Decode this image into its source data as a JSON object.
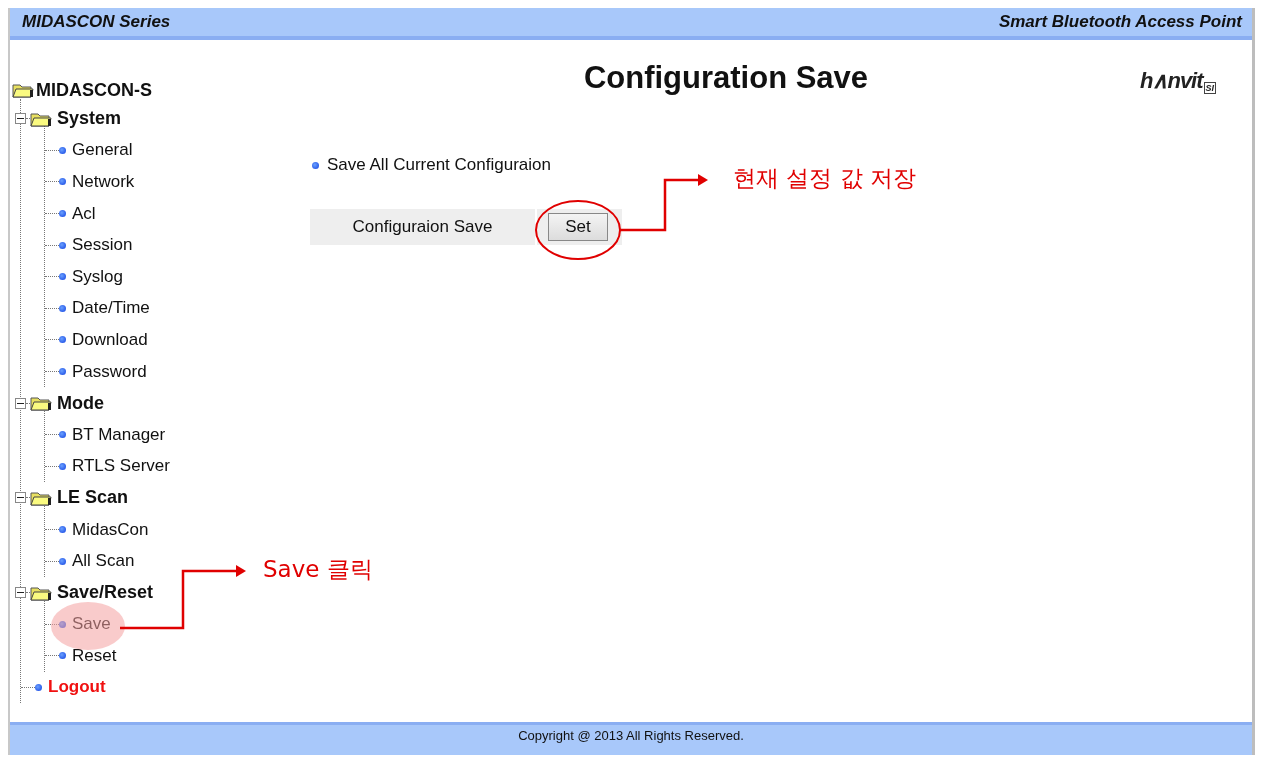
{
  "header": {
    "left": "MIDASCON Series",
    "right": "Smart Bluetooth Access Point"
  },
  "tree": {
    "label": "MIDASCON-S",
    "children": [
      {
        "label": "System",
        "kind": "group",
        "expanded": true,
        "children": [
          {
            "label": "General",
            "kind": "page"
          },
          {
            "label": "Network",
            "kind": "page"
          },
          {
            "label": "Acl",
            "kind": "page"
          },
          {
            "label": "Session",
            "kind": "page"
          },
          {
            "label": "Syslog",
            "kind": "page"
          },
          {
            "label": "Date/Time",
            "kind": "page"
          },
          {
            "label": "Download",
            "kind": "page"
          },
          {
            "label": "Password",
            "kind": "page"
          }
        ]
      },
      {
        "label": "Mode",
        "kind": "group",
        "expanded": true,
        "children": [
          {
            "label": "BT Manager",
            "kind": "page"
          },
          {
            "label": "RTLS Server",
            "kind": "page"
          }
        ]
      },
      {
        "label": "LE Scan",
        "kind": "group",
        "expanded": true,
        "children": [
          {
            "label": "MidasCon",
            "kind": "page"
          },
          {
            "label": "All Scan",
            "kind": "page"
          }
        ]
      },
      {
        "label": "Save/Reset",
        "kind": "group",
        "expanded": true,
        "children": [
          {
            "label": "Save",
            "kind": "page"
          },
          {
            "label": "Reset",
            "kind": "page"
          }
        ]
      },
      {
        "label": "Logout",
        "kind": "logout"
      }
    ]
  },
  "main": {
    "title": "Configuration Save",
    "logo": {
      "text": "h∧nvit",
      "mark": "SI"
    },
    "section": "Save All Current Configuraion",
    "row": {
      "label": "Configuraion Save",
      "button": "Set"
    }
  },
  "annotations": [
    {
      "kind": "callout",
      "text": "Save 클릭"
    },
    {
      "kind": "callout",
      "text": "현재 설정 값 저장"
    }
  ],
  "footer": "Copyright @ 2013 All Rights Reserved."
}
